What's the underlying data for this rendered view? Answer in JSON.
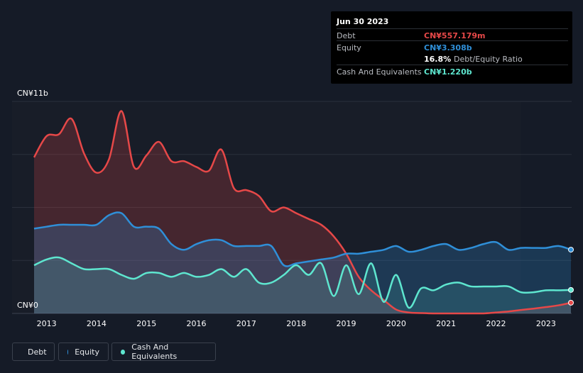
{
  "tooltip": {
    "date": "Jun 30 2023",
    "debt_label": "Debt",
    "debt_value": "CN¥557.179m",
    "equity_label": "Equity",
    "equity_value": "CN¥3.308b",
    "ratio_value": "16.8%",
    "ratio_label": "Debt/Equity Ratio",
    "cash_label": "Cash And Equivalents",
    "cash_value": "CN¥1.220b"
  },
  "legend": {
    "debt": "Debt",
    "equity": "Equity",
    "cash": "Cash And Equivalents"
  },
  "chart_data": {
    "type": "area",
    "title": "",
    "ylabel_top": "CN¥11b",
    "ylabel_bottom": "CN¥0",
    "ylim": [
      0,
      11
    ],
    "xlim": [
      2012.75,
      2023.5
    ],
    "x_ticks": [
      "2013",
      "2014",
      "2015",
      "2016",
      "2017",
      "2018",
      "2019",
      "2020",
      "2021",
      "2022",
      "2023"
    ],
    "grid": true,
    "legend_position": "bottom-left",
    "colors": {
      "debt": "#e64848",
      "equity": "#2f8fd8",
      "cash": "#5ee6cf"
    },
    "series": [
      {
        "name": "Debt",
        "x": [
          2012.75,
          2013.0,
          2013.25,
          2013.5,
          2013.75,
          2014.0,
          2014.25,
          2014.5,
          2014.75,
          2015.0,
          2015.25,
          2015.5,
          2015.75,
          2016.0,
          2016.25,
          2016.5,
          2016.75,
          2017.0,
          2017.25,
          2017.5,
          2017.75,
          2018.0,
          2018.25,
          2018.5,
          2018.75,
          2019.0,
          2019.25,
          2019.5,
          2019.75,
          2020.0,
          2020.25,
          2020.5,
          2020.75,
          2021.0,
          2021.25,
          2021.5,
          2021.75,
          2022.0,
          2022.25,
          2022.5,
          2022.75,
          2023.0,
          2023.25,
          2023.5
        ],
        "values": [
          8.1,
          9.2,
          9.3,
          10.1,
          8.3,
          7.3,
          8.0,
          10.5,
          7.6,
          8.2,
          8.9,
          7.9,
          7.9,
          7.6,
          7.4,
          8.5,
          6.5,
          6.4,
          6.1,
          5.3,
          5.5,
          5.2,
          4.9,
          4.6,
          4.0,
          3.1,
          1.9,
          1.2,
          0.7,
          0.2,
          0.05,
          0.02,
          0.0,
          0.0,
          0.0,
          0.0,
          0.0,
          0.05,
          0.1,
          0.18,
          0.25,
          0.33,
          0.42,
          0.557
        ]
      },
      {
        "name": "Equity",
        "x": [
          2012.75,
          2013.0,
          2013.25,
          2013.5,
          2013.75,
          2014.0,
          2014.25,
          2014.5,
          2014.75,
          2015.0,
          2015.25,
          2015.5,
          2015.75,
          2016.0,
          2016.25,
          2016.5,
          2016.75,
          2017.0,
          2017.25,
          2017.5,
          2017.75,
          2018.0,
          2018.25,
          2018.5,
          2018.75,
          2019.0,
          2019.25,
          2019.5,
          2019.75,
          2020.0,
          2020.25,
          2020.5,
          2020.75,
          2021.0,
          2021.25,
          2021.5,
          2021.75,
          2022.0,
          2022.25,
          2022.5,
          2022.75,
          2023.0,
          2023.25,
          2023.5
        ],
        "values": [
          4.4,
          4.5,
          4.6,
          4.6,
          4.6,
          4.6,
          5.1,
          5.2,
          4.5,
          4.5,
          4.4,
          3.6,
          3.3,
          3.6,
          3.8,
          3.8,
          3.5,
          3.5,
          3.5,
          3.5,
          2.5,
          2.6,
          2.7,
          2.8,
          2.9,
          3.1,
          3.1,
          3.2,
          3.3,
          3.5,
          3.2,
          3.3,
          3.5,
          3.6,
          3.3,
          3.4,
          3.6,
          3.7,
          3.3,
          3.4,
          3.4,
          3.4,
          3.5,
          3.308
        ]
      },
      {
        "name": "Cash And Equivalents",
        "x": [
          2012.75,
          2013.0,
          2013.25,
          2013.5,
          2013.75,
          2014.0,
          2014.25,
          2014.5,
          2014.75,
          2015.0,
          2015.25,
          2015.5,
          2015.75,
          2016.0,
          2016.25,
          2016.5,
          2016.75,
          2017.0,
          2017.25,
          2017.5,
          2017.75,
          2018.0,
          2018.25,
          2018.5,
          2018.75,
          2019.0,
          2019.25,
          2019.5,
          2019.75,
          2020.0,
          2020.25,
          2020.5,
          2020.75,
          2021.0,
          2021.25,
          2021.5,
          2021.75,
          2022.0,
          2022.25,
          2022.5,
          2022.75,
          2023.0,
          2023.25,
          2023.5
        ],
        "values": [
          2.5,
          2.8,
          2.9,
          2.6,
          2.3,
          2.3,
          2.3,
          2.0,
          1.8,
          2.1,
          2.1,
          1.9,
          2.1,
          1.9,
          2.0,
          2.3,
          1.9,
          2.3,
          1.6,
          1.6,
          2.0,
          2.5,
          2.0,
          2.6,
          0.9,
          2.5,
          1.0,
          2.6,
          0.6,
          2.0,
          0.3,
          1.3,
          1.2,
          1.5,
          1.6,
          1.4,
          1.4,
          1.4,
          1.4,
          1.1,
          1.1,
          1.2,
          1.2,
          1.22
        ]
      }
    ]
  }
}
